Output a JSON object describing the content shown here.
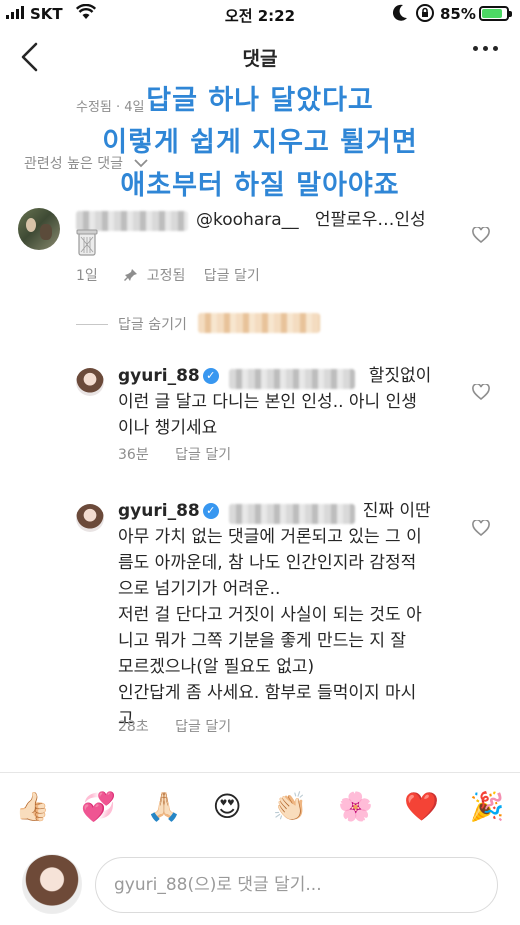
{
  "status_bar": {
    "carrier": "SKT",
    "time": "오전 2:22",
    "battery_percent": "85%",
    "battery_level": 0.85
  },
  "header": {
    "title": "댓글"
  },
  "post": {
    "edited_label": "수정됨 · 4일",
    "related_label": "관련성 높은 댓글"
  },
  "overlay_caption": {
    "line1": "답글 하나 달았다고",
    "line2": "이렇게 쉽게 지우고 튈거면",
    "line3": "애초부터 하질 말아야죠"
  },
  "comments": [
    {
      "mention": "@koohara__",
      "text": "언팔로우…인성",
      "time": "1일",
      "pinned": "고정됨",
      "reply": "답글 달기",
      "icons": [
        "wastebasket-icon",
        "pin-icon",
        "heart-icon"
      ]
    }
  ],
  "hide_replies": {
    "label": "답글 숨기기"
  },
  "replies": [
    {
      "username": "gyuri_88",
      "line1": "할짓없이",
      "line2": "이런 글 달고 다니는 본인 인성.. 아니 인생",
      "line3": "이나 챙기세요",
      "time": "36분",
      "reply": "답글 달기"
    },
    {
      "username": "gyuri_88",
      "line1": "진짜 이딴",
      "line2": "아무 가치 없는 댓글에 거론되고 있는 그 이",
      "line3": "름도 아까운데, 참 나도 인간인지라 감정적",
      "line4": "으로 넘기기가 어려운..",
      "line5": "저런 걸 단다고 거짓이 사실이 되는 것도 아",
      "line6": "니고 뭐가 그쪽 기분을 좋게 만드는 지 잘",
      "line7": "모르겠으나(알 필요도 없고)",
      "line8": "인간답게 좀 사세요. 함부로 들먹이지 마시",
      "line9": "고",
      "time": "28초",
      "reply": "답글 달기"
    }
  ],
  "emoji_bar": {
    "items": [
      "👍🏻",
      "💞",
      "🙏🏻",
      "😍",
      "👏🏻",
      "🌸",
      "❤️",
      "🎉"
    ],
    "icons": [
      "thumbs-up-icon",
      "revolving-hearts-icon",
      "folded-hands-icon",
      "heart-eyes-icon",
      "clapping-hands-icon",
      "cherry-blossom-icon",
      "red-heart-icon",
      "party-popper-icon"
    ]
  },
  "composer": {
    "placeholder": "gyuri_88(으)로 댓글 달기..."
  },
  "colors": {
    "overlay_text": "#2f86d6",
    "verified": "#3897f0",
    "battery": "#4cd964",
    "muted": "#8e8e8e"
  }
}
